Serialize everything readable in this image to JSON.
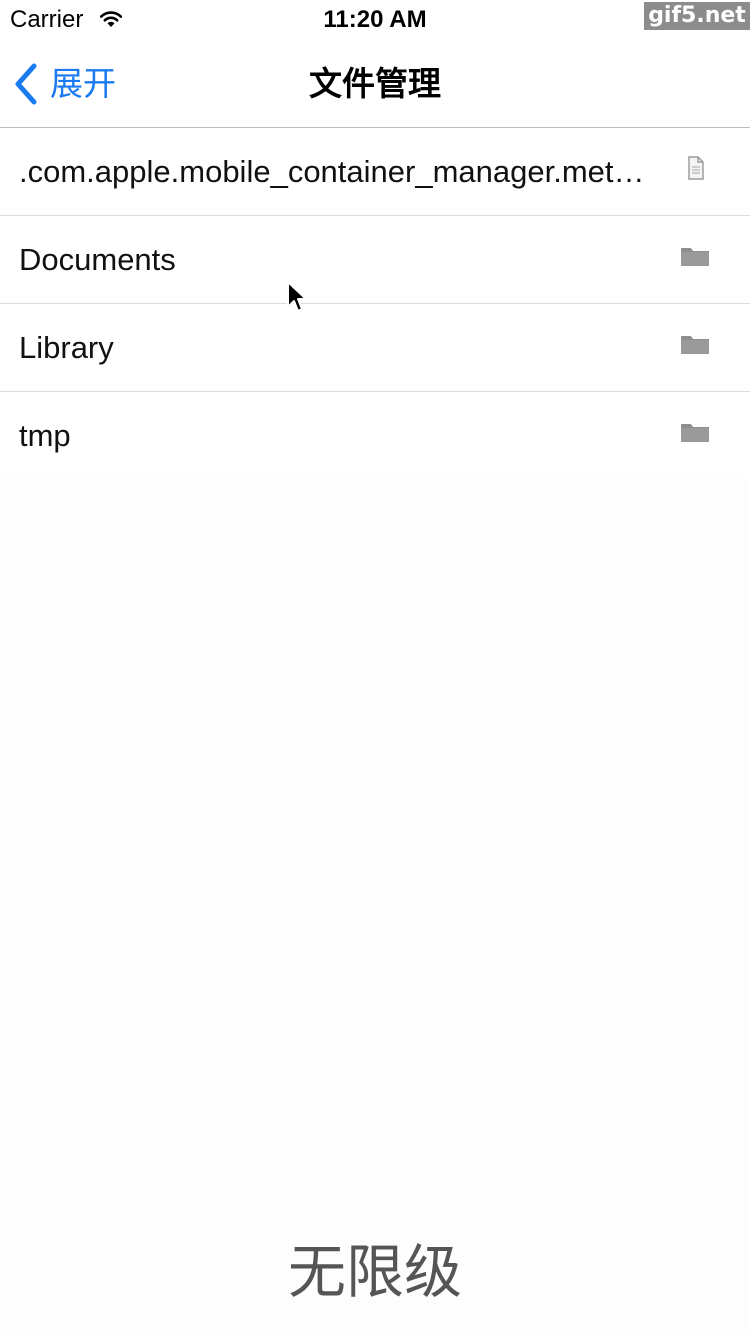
{
  "status_bar": {
    "carrier": "Carrier",
    "time": "11:20 AM",
    "watermark": "gif5.net"
  },
  "nav": {
    "back_label": "展开",
    "title": "文件管理",
    "accent_color": "#1a7bf0"
  },
  "files": [
    {
      "name": ".com.apple.mobile_container_manager.metadata.plist",
      "icon": "document-icon"
    },
    {
      "name": "Documents",
      "icon": "folder-icon"
    },
    {
      "name": "Library",
      "icon": "folder-icon"
    },
    {
      "name": "tmp",
      "icon": "folder-icon"
    }
  ],
  "caption": "无限级"
}
